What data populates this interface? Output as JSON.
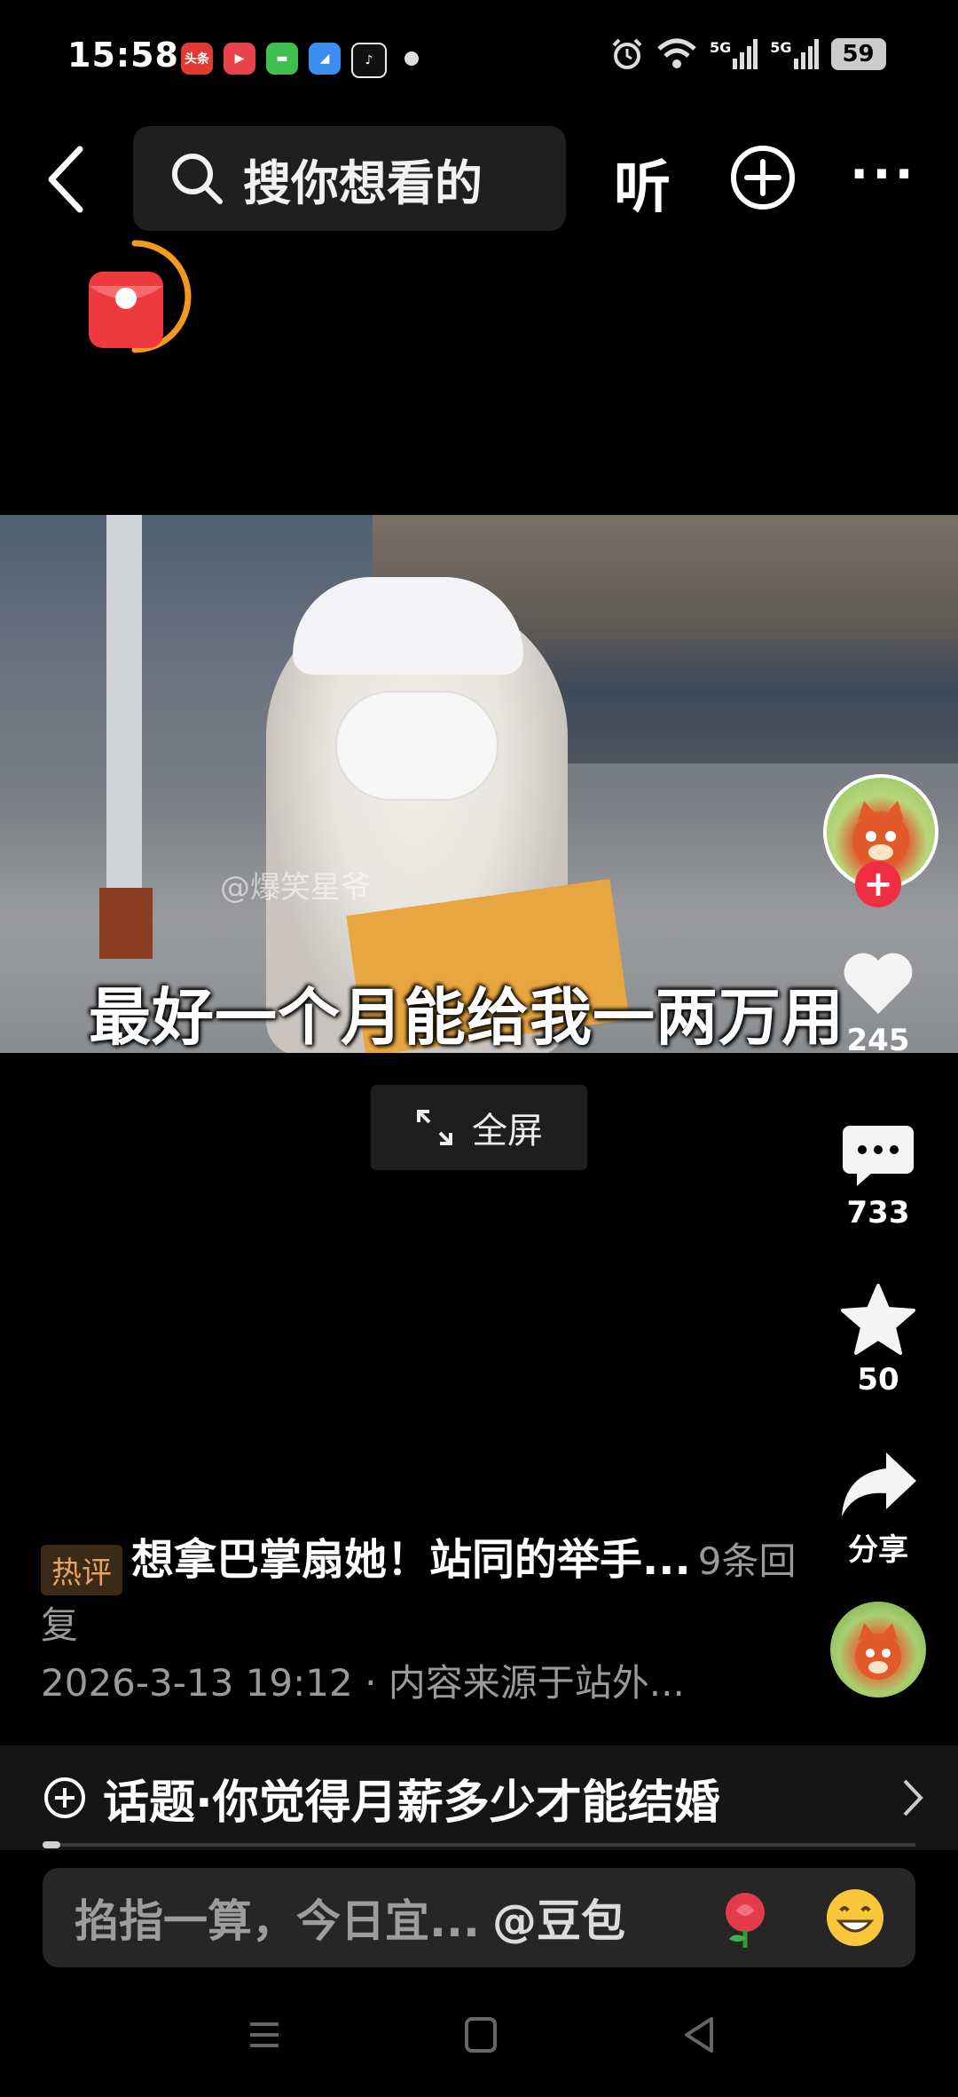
{
  "status_bar": {
    "time": "15:58",
    "battery": "59",
    "network_1": "5G",
    "network_2": "5G",
    "app_icons": [
      "toutiao-icon",
      "video-icon",
      "message-icon",
      "browser-icon",
      "tiktok-icon"
    ],
    "toutiao_label": "头条"
  },
  "header": {
    "search_placeholder": "搜你想看的",
    "listen_label": "听"
  },
  "video": {
    "watermark": "@爆笑星爷",
    "subtitle": "最好一个月能给我一两万用",
    "fullscreen_label": "全屏"
  },
  "rail": {
    "like_count": "245",
    "comment_count": "733",
    "favorite_count": "50",
    "share_label": "分享"
  },
  "caption": {
    "tag": "热评",
    "title": "想拿巴掌扇她！站同的举手...",
    "reply": "9条回复",
    "meta": "2026-3-13 19:12 · 内容来源于站外..."
  },
  "topic": {
    "label": "话题·你觉得月薪多少才能结婚",
    "progress": 0.02
  },
  "comment_bar": {
    "placeholder": "掐指一算，今日宜...",
    "mention": "@豆包"
  },
  "colors": {
    "accent_red": "#ef2d43",
    "hot_tag": "#e8a35c",
    "loader_orange": "#f39a1e"
  }
}
